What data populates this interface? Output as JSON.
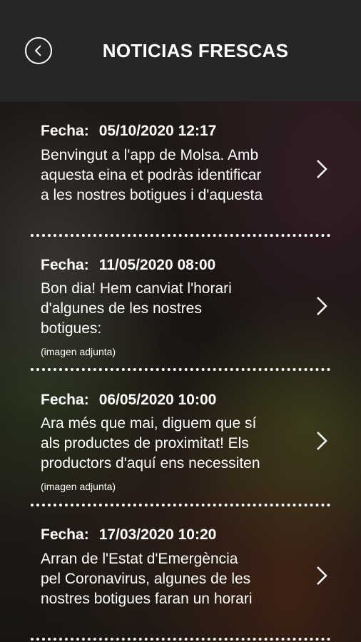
{
  "header": {
    "title": "NOTICIAS FRESCAS",
    "back_icon": "chevron-left-icon"
  },
  "news": [
    {
      "label": "Fecha:",
      "date": "05/10/2020 12:17",
      "line1": "Benvingut a l'app de Molsa. Amb",
      "line2": "aquesta eina et podràs identificar",
      "line3": "a les nostres botigues i d'aquesta",
      "attachment": ""
    },
    {
      "label": "Fecha:",
      "date": "11/05/2020 08:00",
      "line1": "Bon dia! Hem canviat l'horari",
      "line2": "d'algunes de les nostres",
      "line3": "botigues:",
      "attachment": "(imagen adjunta)"
    },
    {
      "label": "Fecha:",
      "date": "06/05/2020 10:00",
      "line1": "Ara més que mai, diguem que sí",
      "line2": "als productes de proximitat! Els",
      "line3": "productors d'aquí ens necessiten",
      "attachment": "(imagen adjunta)"
    },
    {
      "label": "Fecha:",
      "date": "17/03/2020 10:20",
      "line1": "Arran de l'Estat d'Emergència",
      "line2": "pel Coronavirus, algunes de les",
      "line3": "nostres botigues faran un horari",
      "attachment": ""
    }
  ]
}
